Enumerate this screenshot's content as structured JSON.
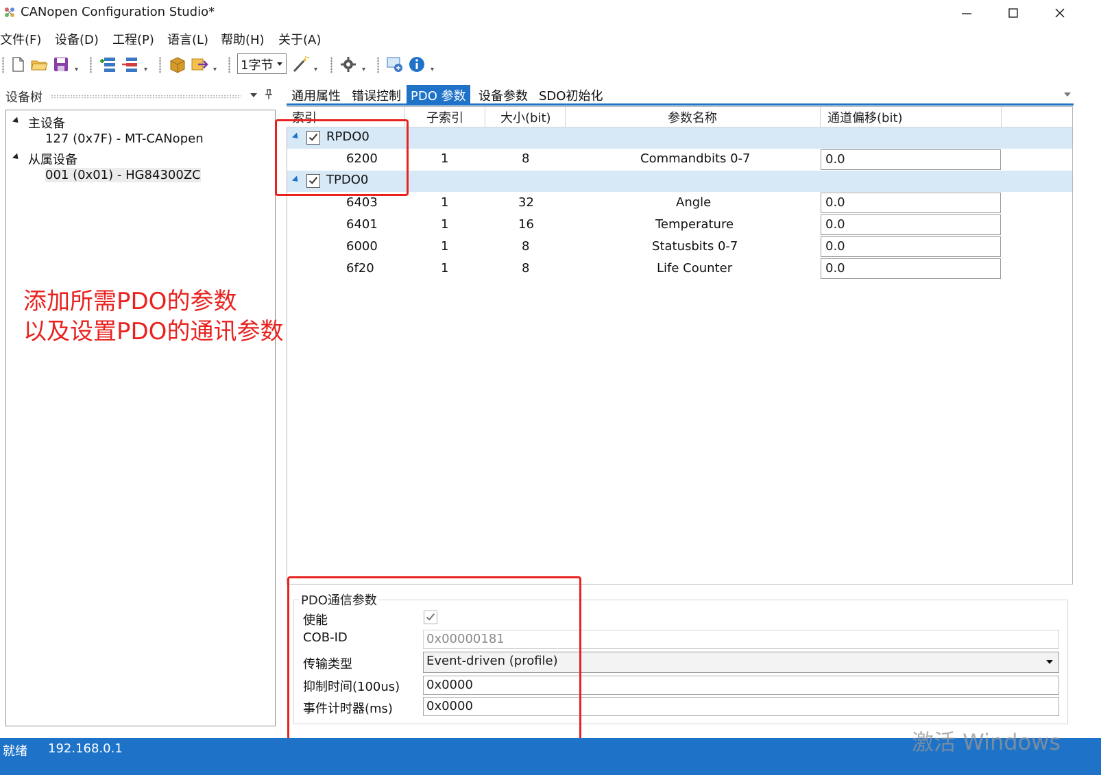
{
  "window": {
    "title": "CANopen Configuration Studio*",
    "controls": [
      "minimize-icon",
      "maximize-icon",
      "close-icon"
    ]
  },
  "menu": [
    "文件(F)",
    "设备(D)",
    "工程(P)",
    "语言(L)",
    "帮助(H)",
    "关于(A)"
  ],
  "toolbar": {
    "byte_select": "1字节",
    "icons": [
      "new-file-icon",
      "open-folder-icon",
      "save-icon",
      "add-device-icon",
      "remove-device-icon",
      "package-icon",
      "export-icon",
      "magic-wand-icon",
      "settings-gear-icon",
      "monitor-icon",
      "info-icon"
    ]
  },
  "device_tree": {
    "header": "设备树",
    "groups": [
      {
        "label": "主设备",
        "children": [
          "127 (0x7F)  -  MT-CANopen"
        ]
      },
      {
        "label": "从属设备",
        "children": [
          "001 (0x01)  -  HG84300ZC"
        ]
      }
    ]
  },
  "annotation": {
    "line1": "添加所需PDO的参数",
    "line2": "以及设置PDO的通讯参数"
  },
  "tabs": [
    {
      "label": "通用属性",
      "active": false
    },
    {
      "label": "错误控制",
      "active": false
    },
    {
      "label": "PDO 参数",
      "active": true
    },
    {
      "label": "设备参数",
      "active": false
    },
    {
      "label": "SDO初始化",
      "active": false
    }
  ],
  "grid": {
    "columns": [
      "索引",
      "子索引",
      "大小(bit)",
      "参数名称",
      "通道偏移(bit)"
    ],
    "groups": [
      {
        "name": "RPDO0",
        "checked": true,
        "rows": [
          {
            "index": "6200",
            "subindex": "1",
            "size": "8",
            "name": "Commandbits 0-7",
            "offset": "0.0"
          }
        ]
      },
      {
        "name": "TPDO0",
        "checked": true,
        "rows": [
          {
            "index": "6403",
            "subindex": "1",
            "size": "32",
            "name": "Angle",
            "offset": "0.0"
          },
          {
            "index": "6401",
            "subindex": "1",
            "size": "16",
            "name": "Temperature",
            "offset": "0.0"
          },
          {
            "index": "6000",
            "subindex": "1",
            "size": "8",
            "name": "Statusbits 0-7",
            "offset": "0.0"
          },
          {
            "index": "6f20",
            "subindex": "1",
            "size": "8",
            "name": "Life Counter",
            "offset": "0.0"
          }
        ]
      }
    ]
  },
  "pdo_comm": {
    "legend": "PDO通信参数",
    "enable_label": "使能",
    "enable_checked": true,
    "cobid_label": "COB-ID",
    "cobid_value": "0x00000181",
    "transmission_label": "传输类型",
    "transmission_value": "Event-driven (profile)",
    "inhibit_label": "抑制时间(100us)",
    "inhibit_value": "0x0000",
    "event_timer_label": "事件计时器(ms)",
    "event_timer_value": "0x0000"
  },
  "status": {
    "text": "就绪",
    "ip": "192.168.0.1",
    "watermark": "激活 Windows"
  },
  "colors": {
    "accent": "#1e73c8",
    "group_row": "#d7e8f7",
    "annotation_red": "#e8231f"
  }
}
